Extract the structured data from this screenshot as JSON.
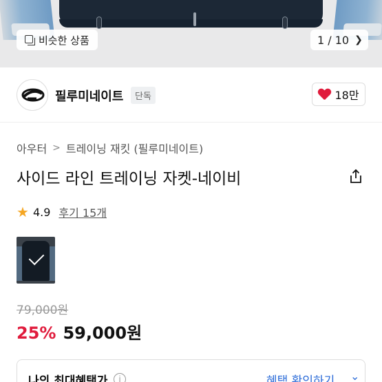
{
  "gallery": {
    "similar_label": "비슷한 상품",
    "similar_icon": "stack-icon",
    "pager": "1 / 10",
    "pager_icon": "chevron-right-icon"
  },
  "brand": {
    "name": "필루미네이트",
    "tag": "단독",
    "likes": "18만",
    "like_icon": "heart-icon",
    "like_color": "#e01b3c"
  },
  "breadcrumb": {
    "items": [
      "아우터",
      "트레이닝 재킷 (필루미네이트)"
    ],
    "separator": ">"
  },
  "product": {
    "title": "사이드 라인 트레이닝 자켓-네이비",
    "share_icon": "share-icon",
    "rating": "4.9",
    "reviews": "후기 15개",
    "star_color": "#f5a623"
  },
  "price": {
    "original": "79,000원",
    "discount": "25%",
    "sale": "59,000원",
    "discount_color": "#e01b3c"
  },
  "benefit": {
    "label": "나의 최대혜택가",
    "info_icon": "info-icon",
    "link": "혜택 확인하기",
    "link_color": "#2b6bd8"
  }
}
